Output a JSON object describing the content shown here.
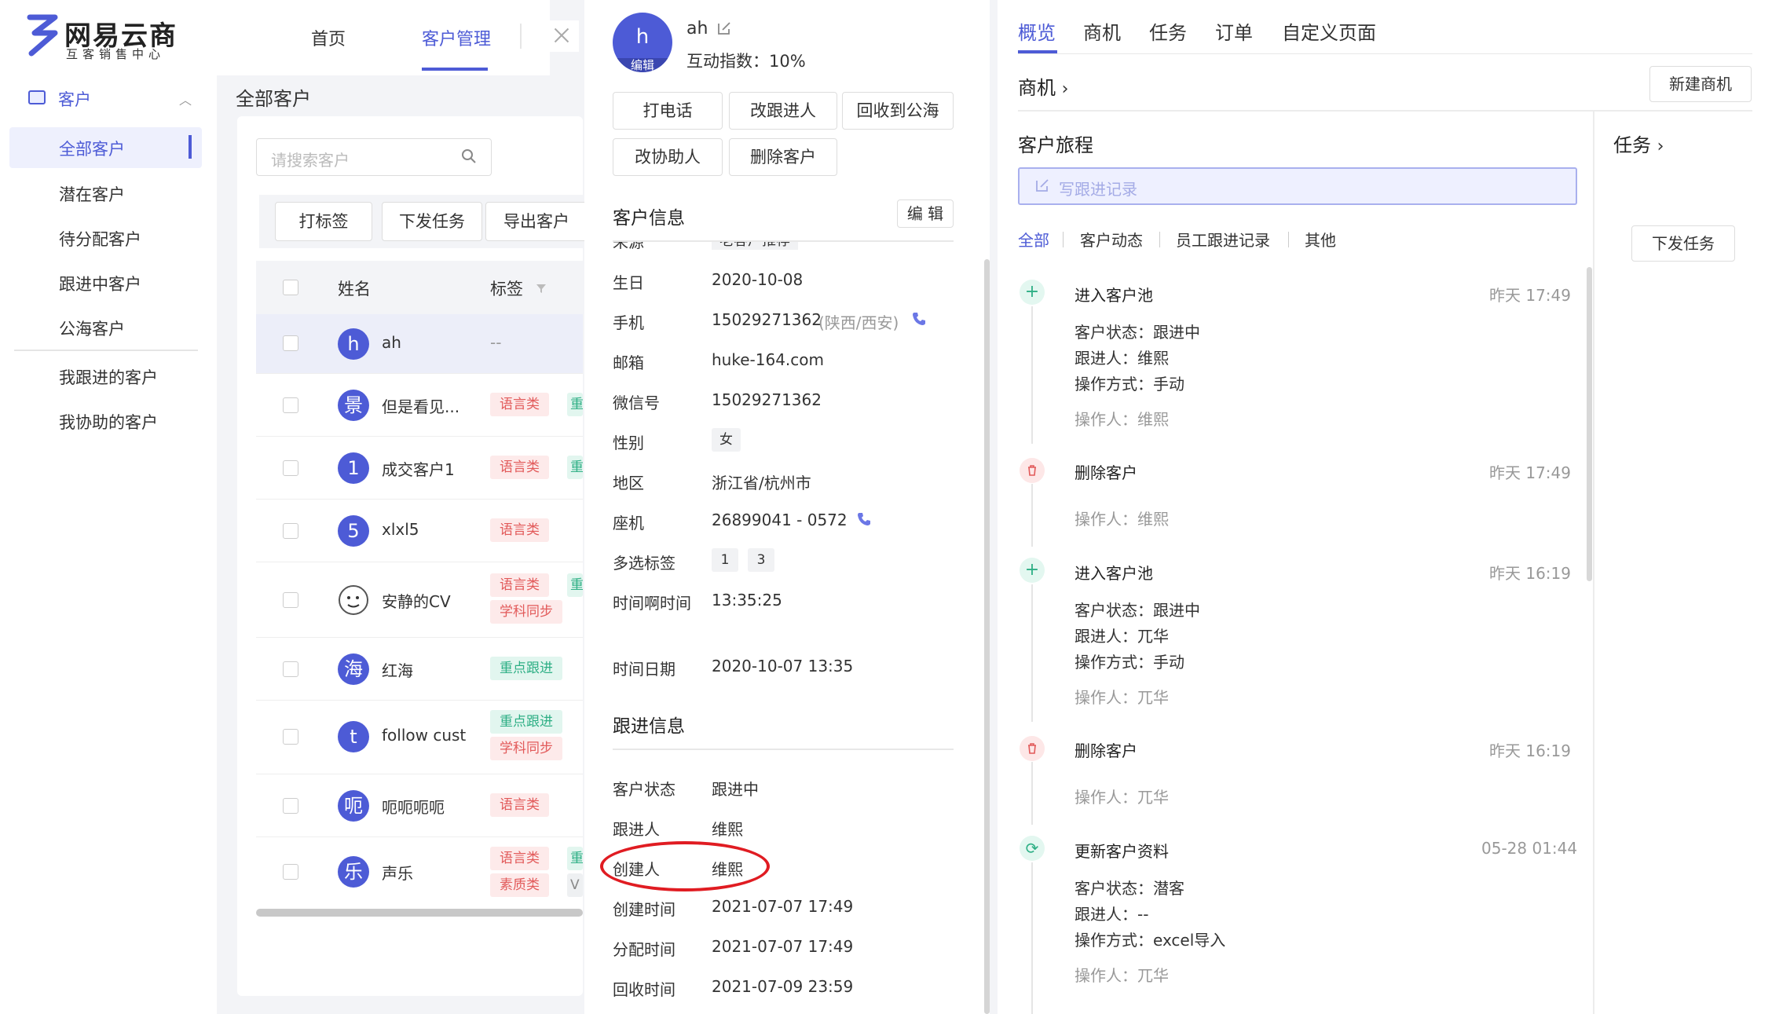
{
  "app": {
    "logo_name": "网易云商",
    "logo_sub": "互客销售中心"
  },
  "topnav": {
    "items": [
      "首页",
      "客户管理"
    ],
    "active_index": 1
  },
  "sidebar": {
    "section_label": "客户",
    "items": [
      "全部客户",
      "潜在客户",
      "待分配客户",
      "跟进中客户",
      "公海客户",
      "我跟进的客户",
      "我协助的客户"
    ],
    "active_index": 0
  },
  "list": {
    "title": "全部客户",
    "search_placeholder": "请搜索客户",
    "toolbar": [
      "打标签",
      "下发任务",
      "导出客户"
    ],
    "columns": [
      "姓名",
      "标签"
    ],
    "rows": [
      {
        "avatar": "h",
        "name": "ah",
        "tags": [
          "--"
        ]
      },
      {
        "avatar": "景",
        "name": "但是看见...",
        "tags": [
          "语言类",
          "重"
        ]
      },
      {
        "avatar": "1",
        "name": "成交客户1",
        "tags": [
          "语言类",
          "重"
        ]
      },
      {
        "avatar": "5",
        "name": "xlxl5",
        "tags": [
          "语言类"
        ]
      },
      {
        "avatar": "face",
        "name": "安静的CV",
        "tags": [
          "语言类",
          "学科同步",
          "重"
        ]
      },
      {
        "avatar": "海",
        "name": "红海",
        "tags": [
          "重点跟进"
        ]
      },
      {
        "avatar": "t",
        "name": "follow cust",
        "tags": [
          "重点跟进",
          "学科同步"
        ]
      },
      {
        "avatar": "呃",
        "name": "呃呃呃呃",
        "tags": [
          "语言类"
        ]
      },
      {
        "avatar": "乐",
        "name": "声乐",
        "tags": [
          "语言类",
          "素质类",
          "重",
          "V"
        ]
      }
    ]
  },
  "drawer": {
    "avatar_letter": "h",
    "avatar_edit": "编辑",
    "name": "ah",
    "interaction": "互动指数：10%",
    "actions": [
      "打电话",
      "改跟进人",
      "回收到公海",
      "改协助人",
      "删除客户"
    ],
    "info_title": "客户信息",
    "info_edit": "编 辑",
    "partial_row": {
      "key": "来源",
      "value": "老客户推荐"
    },
    "info": {
      "birthday_k": "生日",
      "birthday_v": "2020-10-08",
      "mobile_k": "手机",
      "mobile_v": "15029271362",
      "mobile_loc": "(陕西/西安)",
      "email_k": "邮箱",
      "email_v": "huke-164.com",
      "wechat_k": "微信号",
      "wechat_v": "15029271362",
      "gender_k": "性别",
      "gender_v": "女",
      "region_k": "地区",
      "region_v": "浙江省/杭州市",
      "landline_k": "座机",
      "landline_v": "26899041 - 0572",
      "multi_k": "多选标签",
      "multi_v1": "1",
      "multi_v2": "3",
      "time_k": "时间啊时间",
      "time_v": "13:35:25",
      "datetime_k": "时间日期",
      "datetime_v": "2020-10-07 13:35"
    },
    "follow_title": "跟进信息",
    "follow": {
      "status_k": "客户状态",
      "status_v": "跟进中",
      "owner_k": "跟进人",
      "owner_v": "维熙",
      "creator_k": "创建人",
      "creator_v": "维熙",
      "created_k": "创建时间",
      "created_v": "2021-07-07 17:49",
      "assigned_k": "分配时间",
      "assigned_v": "2021-07-07 17:49",
      "recycled_k": "回收时间",
      "recycled_v": "2021-07-09 23:59"
    }
  },
  "right": {
    "tabs": [
      "概览",
      "商机",
      "任务",
      "订单",
      "自定义页面"
    ],
    "active_tab": 0,
    "opp_label": "商机",
    "new_opp": "新建商机",
    "journey_title": "客户旅程",
    "task_label": "任务",
    "issue_task": "下发任务",
    "write_record": "写跟进记录",
    "filters": [
      "全部",
      "客户动态",
      "员工跟进记录",
      "其他"
    ],
    "events": [
      {
        "icon": "plus",
        "title": "进入客户池",
        "time": "昨天 17:49",
        "lines": [
          "客户状态：跟进中",
          "跟进人：维熙",
          "操作方式：手动"
        ],
        "op": "操作人：维熙"
      },
      {
        "icon": "trash",
        "title": "删除客户",
        "time": "昨天 17:49",
        "lines": [],
        "op": "操作人：维熙"
      },
      {
        "icon": "plus",
        "title": "进入客户池",
        "time": "昨天 16:19",
        "lines": [
          "客户状态：跟进中",
          "跟进人：兀华",
          "操作方式：手动"
        ],
        "op": "操作人：兀华"
      },
      {
        "icon": "trash",
        "title": "删除客户",
        "time": "昨天 16:19",
        "lines": [],
        "op": "操作人：兀华"
      },
      {
        "icon": "refresh",
        "title": "更新客户资料",
        "time": "05-28 01:44",
        "lines": [
          "客户状态：潜客",
          "跟进人：--",
          "操作方式：excel导入"
        ],
        "op": "操作人：兀华"
      }
    ]
  },
  "colors": {
    "accent": "#4d5bd6",
    "annotation": "#e01c22"
  }
}
